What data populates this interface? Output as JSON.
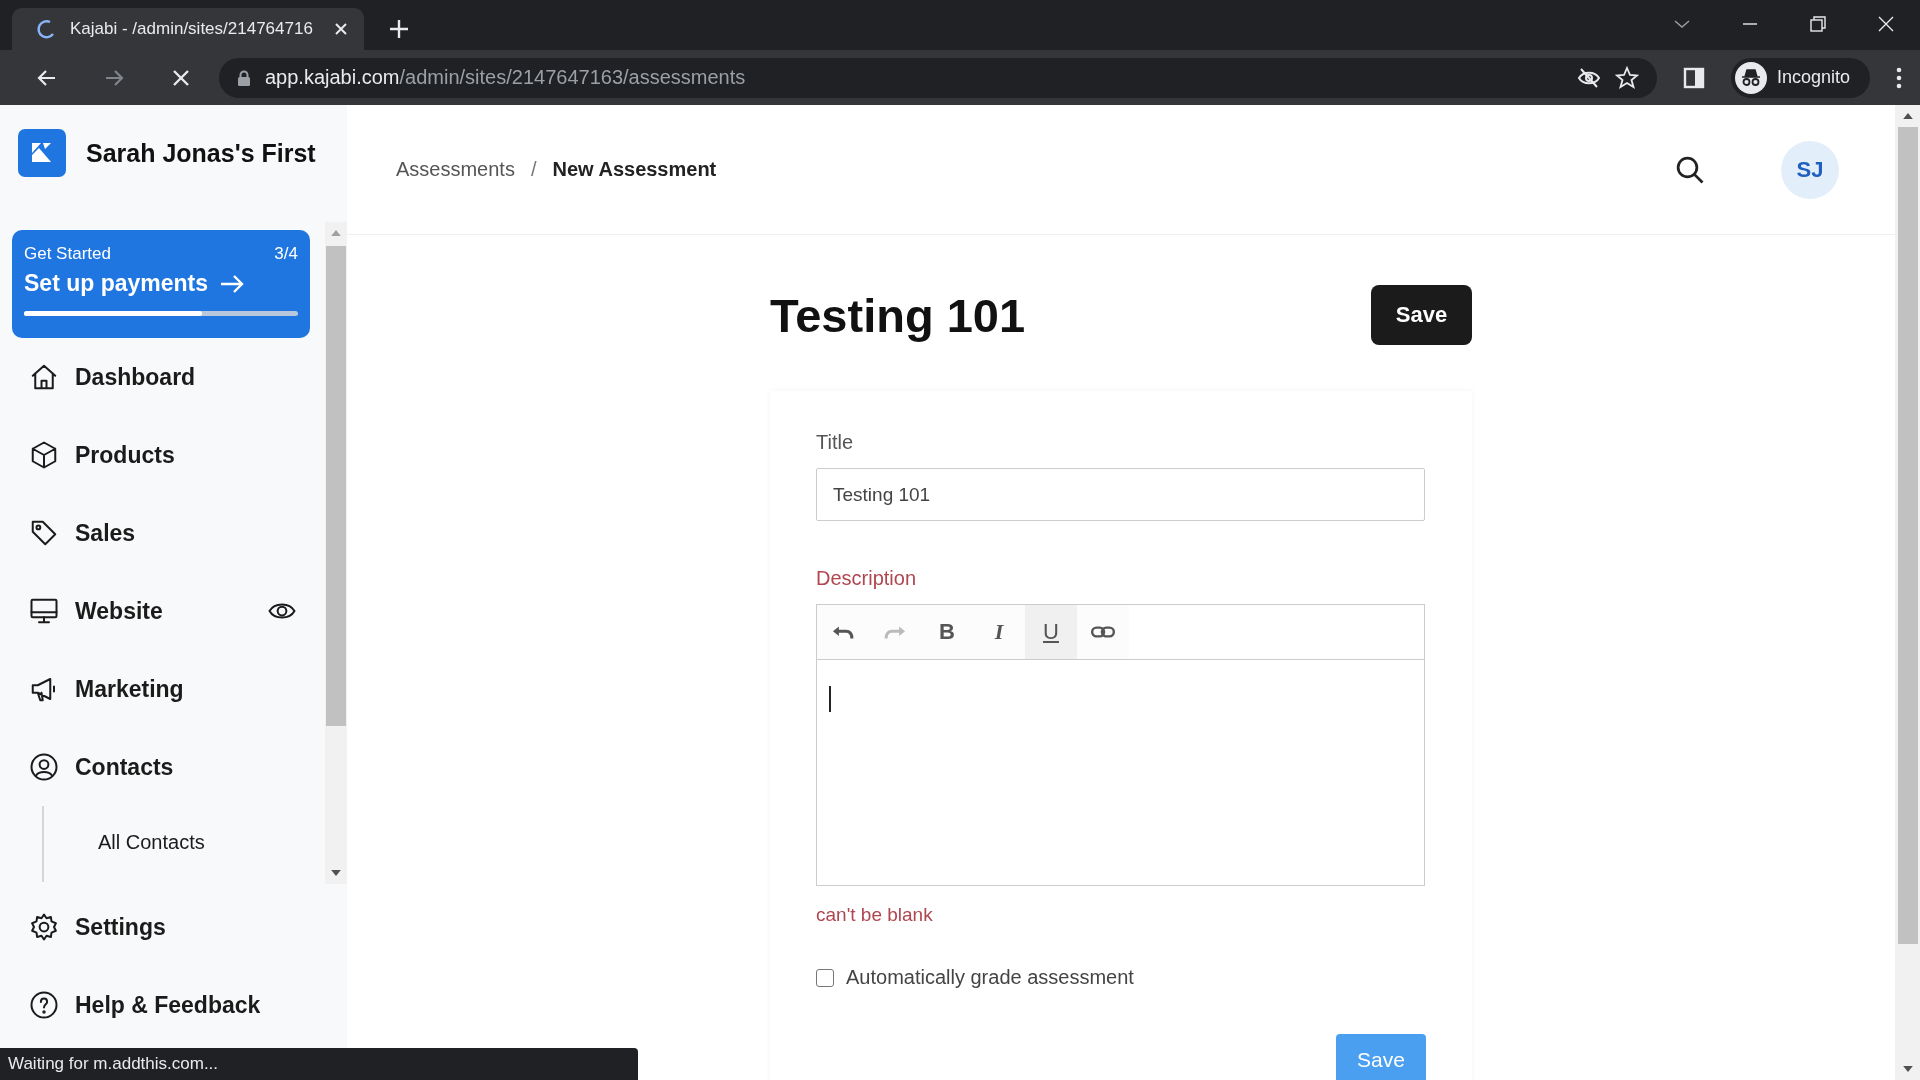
{
  "browser": {
    "tab": {
      "title": "Kajabi - /admin/sites/214764716"
    },
    "url": {
      "host": "app.kajabi.com",
      "path": "/admin/sites/2147647163/assessments"
    },
    "profile": "Incognito",
    "status": "Waiting for m.addthis.com..."
  },
  "sidebar": {
    "site_name": "Sarah Jonas's First",
    "get_started": {
      "label": "Get Started",
      "count": "3/4",
      "action": "Set up payments",
      "level": 0.65
    },
    "items": [
      {
        "label": "Dashboard",
        "kind": "plain"
      },
      {
        "label": "Products",
        "kind": "plain"
      },
      {
        "label": "Sales",
        "kind": "plain"
      },
      {
        "label": "Website",
        "kind": "preview"
      },
      {
        "label": "Marketing",
        "kind": "plain"
      },
      {
        "label": "Contacts",
        "kind": "plain",
        "children": [
          {
            "label": "All Contacts"
          }
        ]
      }
    ],
    "footer_items": [
      {
        "label": "Settings"
      },
      {
        "label": "Help & Feedback"
      }
    ]
  },
  "header": {
    "breadcrumb": [
      "Assessments",
      "New Assessment"
    ],
    "separator": "/",
    "avatar": "SJ"
  },
  "page": {
    "title": "Testing 101",
    "save": "Save",
    "form": {
      "title_label": "Title",
      "title_value": "Testing 101",
      "description_label": "Description",
      "toolbar": [
        {
          "kind": "undo",
          "disabled": false,
          "active": false
        },
        {
          "kind": "redo",
          "disabled": true,
          "active": false
        },
        {
          "kind": "bold",
          "label": "B",
          "disabled": false,
          "active": false
        },
        {
          "kind": "italic",
          "label": "I",
          "disabled": false,
          "active": false
        },
        {
          "kind": "underline",
          "label": "U",
          "disabled": false,
          "active": true
        },
        {
          "kind": "link",
          "disabled": false,
          "active": false
        }
      ],
      "error": "can't be blank",
      "auto_grade": {
        "label": "Automatically grade assessment",
        "checked": false
      },
      "submit": "Save"
    }
  }
}
